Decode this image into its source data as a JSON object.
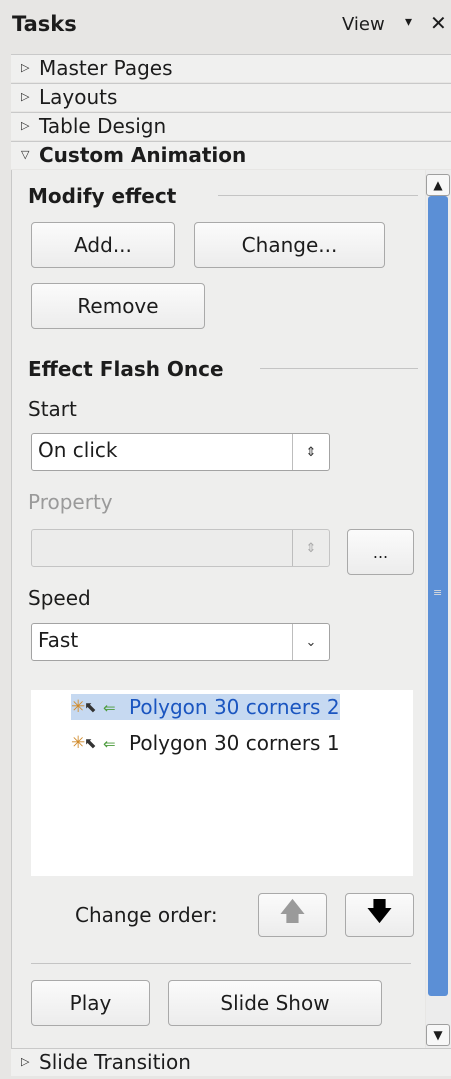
{
  "header": {
    "title": "Tasks",
    "view_label": "View",
    "view_arrow": "▾",
    "close": "✕"
  },
  "sections": {
    "master_pages": "Master Pages",
    "layouts": "Layouts",
    "table_design": "Table Design",
    "custom_animation": "Custom Animation",
    "slide_transition": "Slide Transition"
  },
  "modify": {
    "title": "Modify effect",
    "add": "Add...",
    "change": "Change...",
    "remove": "Remove"
  },
  "effect": {
    "title": "Effect Flash Once",
    "start_label": "Start",
    "start_value": "On click",
    "property_label": "Property",
    "property_value": "",
    "more_button": "...",
    "speed_label": "Speed",
    "speed_value": "Fast"
  },
  "animation_list": [
    {
      "label": "Polygon 30 corners 2",
      "selected": true
    },
    {
      "label": "Polygon 30 corners 1",
      "selected": false
    }
  ],
  "order": {
    "label": "Change order:",
    "up": "🡅",
    "down": "🡇"
  },
  "footer": {
    "play": "Play",
    "slideshow": "Slide Show"
  }
}
